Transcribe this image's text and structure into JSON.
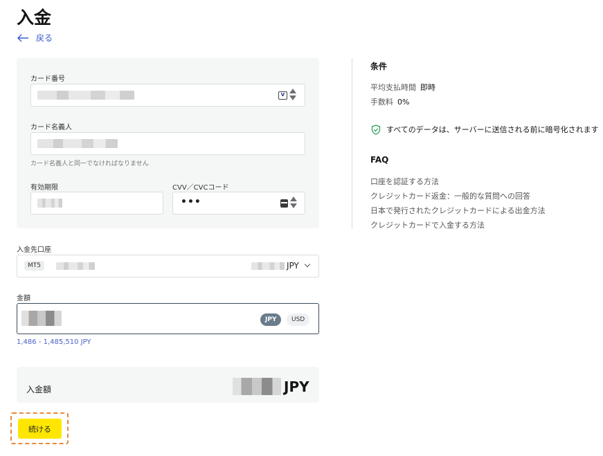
{
  "page": {
    "title": "入金"
  },
  "nav": {
    "back_label": "戻る"
  },
  "card_form": {
    "card_number_label": "カード番号",
    "card_holder_label": "カード名義人",
    "card_holder_hint": "カード名義人と同一でなければなりません",
    "expiry_label": "有効期限",
    "cvv_label": "CVV／CVCコード",
    "cvv_value": "•••",
    "card_brand_icon": "visa-card-icon",
    "cvv_icon": "card-back-icon"
  },
  "account": {
    "label": "入金先口座",
    "platform_tag": "MT5",
    "currency": "JPY"
  },
  "amount": {
    "label": "金額",
    "currency_options": [
      "JPY",
      "USD"
    ],
    "selected_currency": "JPY",
    "range": "1,486 - 1,485,510 JPY"
  },
  "summary": {
    "label": "入金額",
    "currency": "JPY"
  },
  "actions": {
    "continue_label": "続ける"
  },
  "conditions": {
    "title": "条件",
    "items": [
      {
        "key": "平均支払時間",
        "value": "即時"
      },
      {
        "key": "手数料",
        "value": "0%"
      }
    ],
    "security_note": "すべてのデータは、サーバーに送信される前に暗号化されます"
  },
  "faq": {
    "title": "FAQ",
    "links": [
      "口座を認証する方法",
      "クレジットカード返金：一般的な質問への回答",
      "日本で発行されたクレジットカードによる出金方法",
      "クレジットカードで入金する方法"
    ]
  },
  "colors": {
    "accent": "#ffe600",
    "link": "#3a5ccc",
    "panel": "#f5f7f6",
    "highlight_border": "#e8893a",
    "secure_green": "#2e9e5a"
  }
}
